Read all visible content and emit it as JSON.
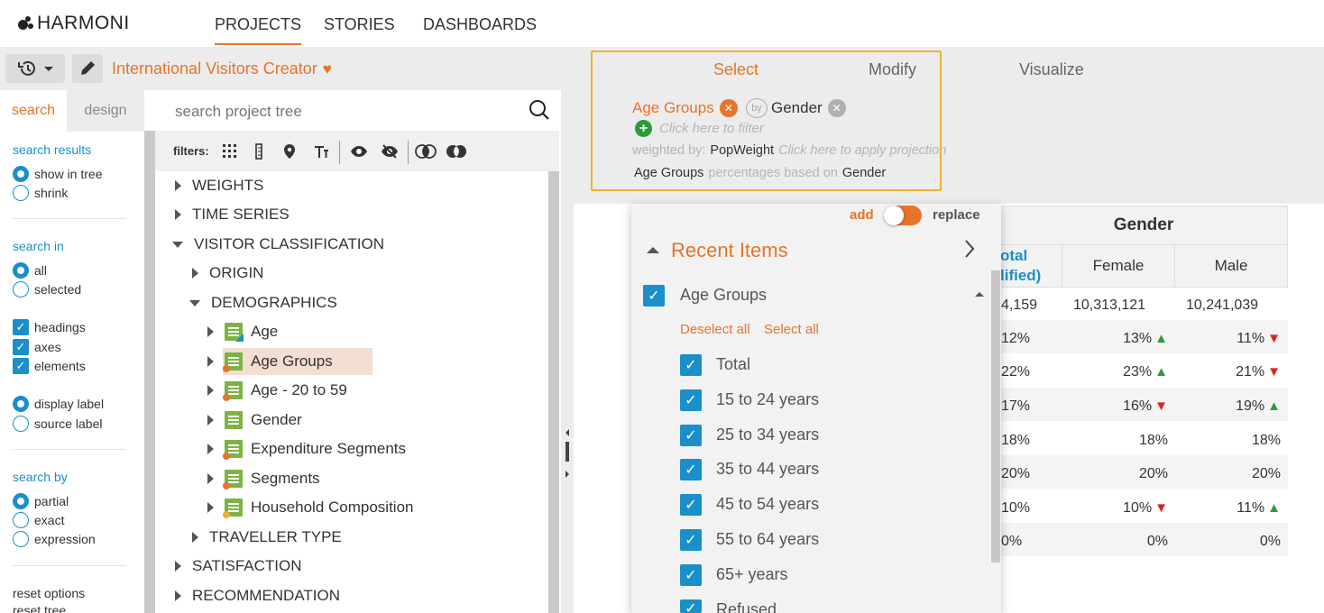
{
  "app": {
    "logo": "HARMONI",
    "nav": [
      "PROJECTS",
      "STORIES",
      "DASHBOARDS"
    ]
  },
  "toolbar": {
    "history_icon": "history-icon",
    "edit_icon": "pencil-icon",
    "project_title": "International Visitors Creator",
    "favorite_icon": "heart-icon"
  },
  "right_tabs": [
    "Select",
    "Modify",
    "Visualize"
  ],
  "left_panel": {
    "tabs": [
      "search",
      "design"
    ],
    "search_results_label": "search results",
    "search_results_opts": [
      "show in tree",
      "shrink"
    ],
    "search_in_label": "search in",
    "search_in_opts": [
      "all",
      "selected"
    ],
    "checks": [
      "headings",
      "axes",
      "elements"
    ],
    "label_opts": [
      "display label",
      "source label"
    ],
    "search_by_label": "search by",
    "search_by_opts": [
      "partial",
      "exact",
      "expression"
    ],
    "links": [
      "reset options",
      "reset tree"
    ]
  },
  "tree": {
    "search_placeholder": "search project tree",
    "filters_label": "filters:",
    "items": [
      {
        "label": "WEIGHTS"
      },
      {
        "label": "TIME SERIES"
      },
      {
        "label": "VISITOR CLASSIFICATION"
      },
      {
        "label": "ORIGIN"
      },
      {
        "label": "DEMOGRAPHICS"
      },
      {
        "label": "Age"
      },
      {
        "label": "Age Groups"
      },
      {
        "label": "Age - 20 to 59"
      },
      {
        "label": "Gender"
      },
      {
        "label": "Expenditure Segments"
      },
      {
        "label": "Segments"
      },
      {
        "label": "Household Composition"
      },
      {
        "label": "TRAVELLER TYPE"
      },
      {
        "label": "SATISFACTION"
      },
      {
        "label": "RECOMMENDATION"
      }
    ]
  },
  "select": {
    "row_var": "Age Groups",
    "by": "by",
    "col_var": "Gender",
    "filter_hint": "Click here to filter",
    "weighted_by_label": "weighted by:",
    "weight": "PopWeight",
    "projection_hint": "Click here to apply projection",
    "pct_row": "Age Groups",
    "pct_mid": "percentages based on",
    "pct_col": "Gender"
  },
  "table": {
    "header": "Gender",
    "col_partial": "otal\nlified)",
    "col_partial_top": "otal",
    "col_partial_bot": "lified)",
    "cols": [
      "Female",
      "Male"
    ],
    "rows": [
      {
        "total": "4,159",
        "female": "10,313,121",
        "female_arrow": "",
        "male": "10,241,039",
        "male_arrow": ""
      },
      {
        "total": "12%",
        "female": "13%",
        "female_arrow": "up",
        "male": "11%",
        "male_arrow": "down"
      },
      {
        "total": "22%",
        "female": "23%",
        "female_arrow": "up",
        "male": "21%",
        "male_arrow": "down"
      },
      {
        "total": "17%",
        "female": "16%",
        "female_arrow": "down",
        "male": "19%",
        "male_arrow": "up"
      },
      {
        "total": "18%",
        "female": "18%",
        "female_arrow": "",
        "male": "18%",
        "male_arrow": ""
      },
      {
        "total": "20%",
        "female": "20%",
        "female_arrow": "",
        "male": "20%",
        "male_arrow": ""
      },
      {
        "total": "10%",
        "female": "10%",
        "female_arrow": "down",
        "male": "11%",
        "male_arrow": "up"
      },
      {
        "total": "0%",
        "female": "0%",
        "female_arrow": "",
        "male": "0%",
        "male_arrow": ""
      }
    ]
  },
  "dropdown": {
    "add": "add",
    "replace": "replace",
    "recent": "Recent Items",
    "group": "Age Groups",
    "deselect_all": "Deselect all",
    "select_all": "Select all",
    "items": [
      "Total",
      "15 to 24 years",
      "25 to 34 years",
      "35 to 44 years",
      "45 to 54 years",
      "55 to 64 years",
      "65+ years",
      "Refused"
    ]
  },
  "colors": {
    "accent": "#e8732a",
    "blue": "#1a8fc9",
    "highlight_box": "#f0b030"
  }
}
